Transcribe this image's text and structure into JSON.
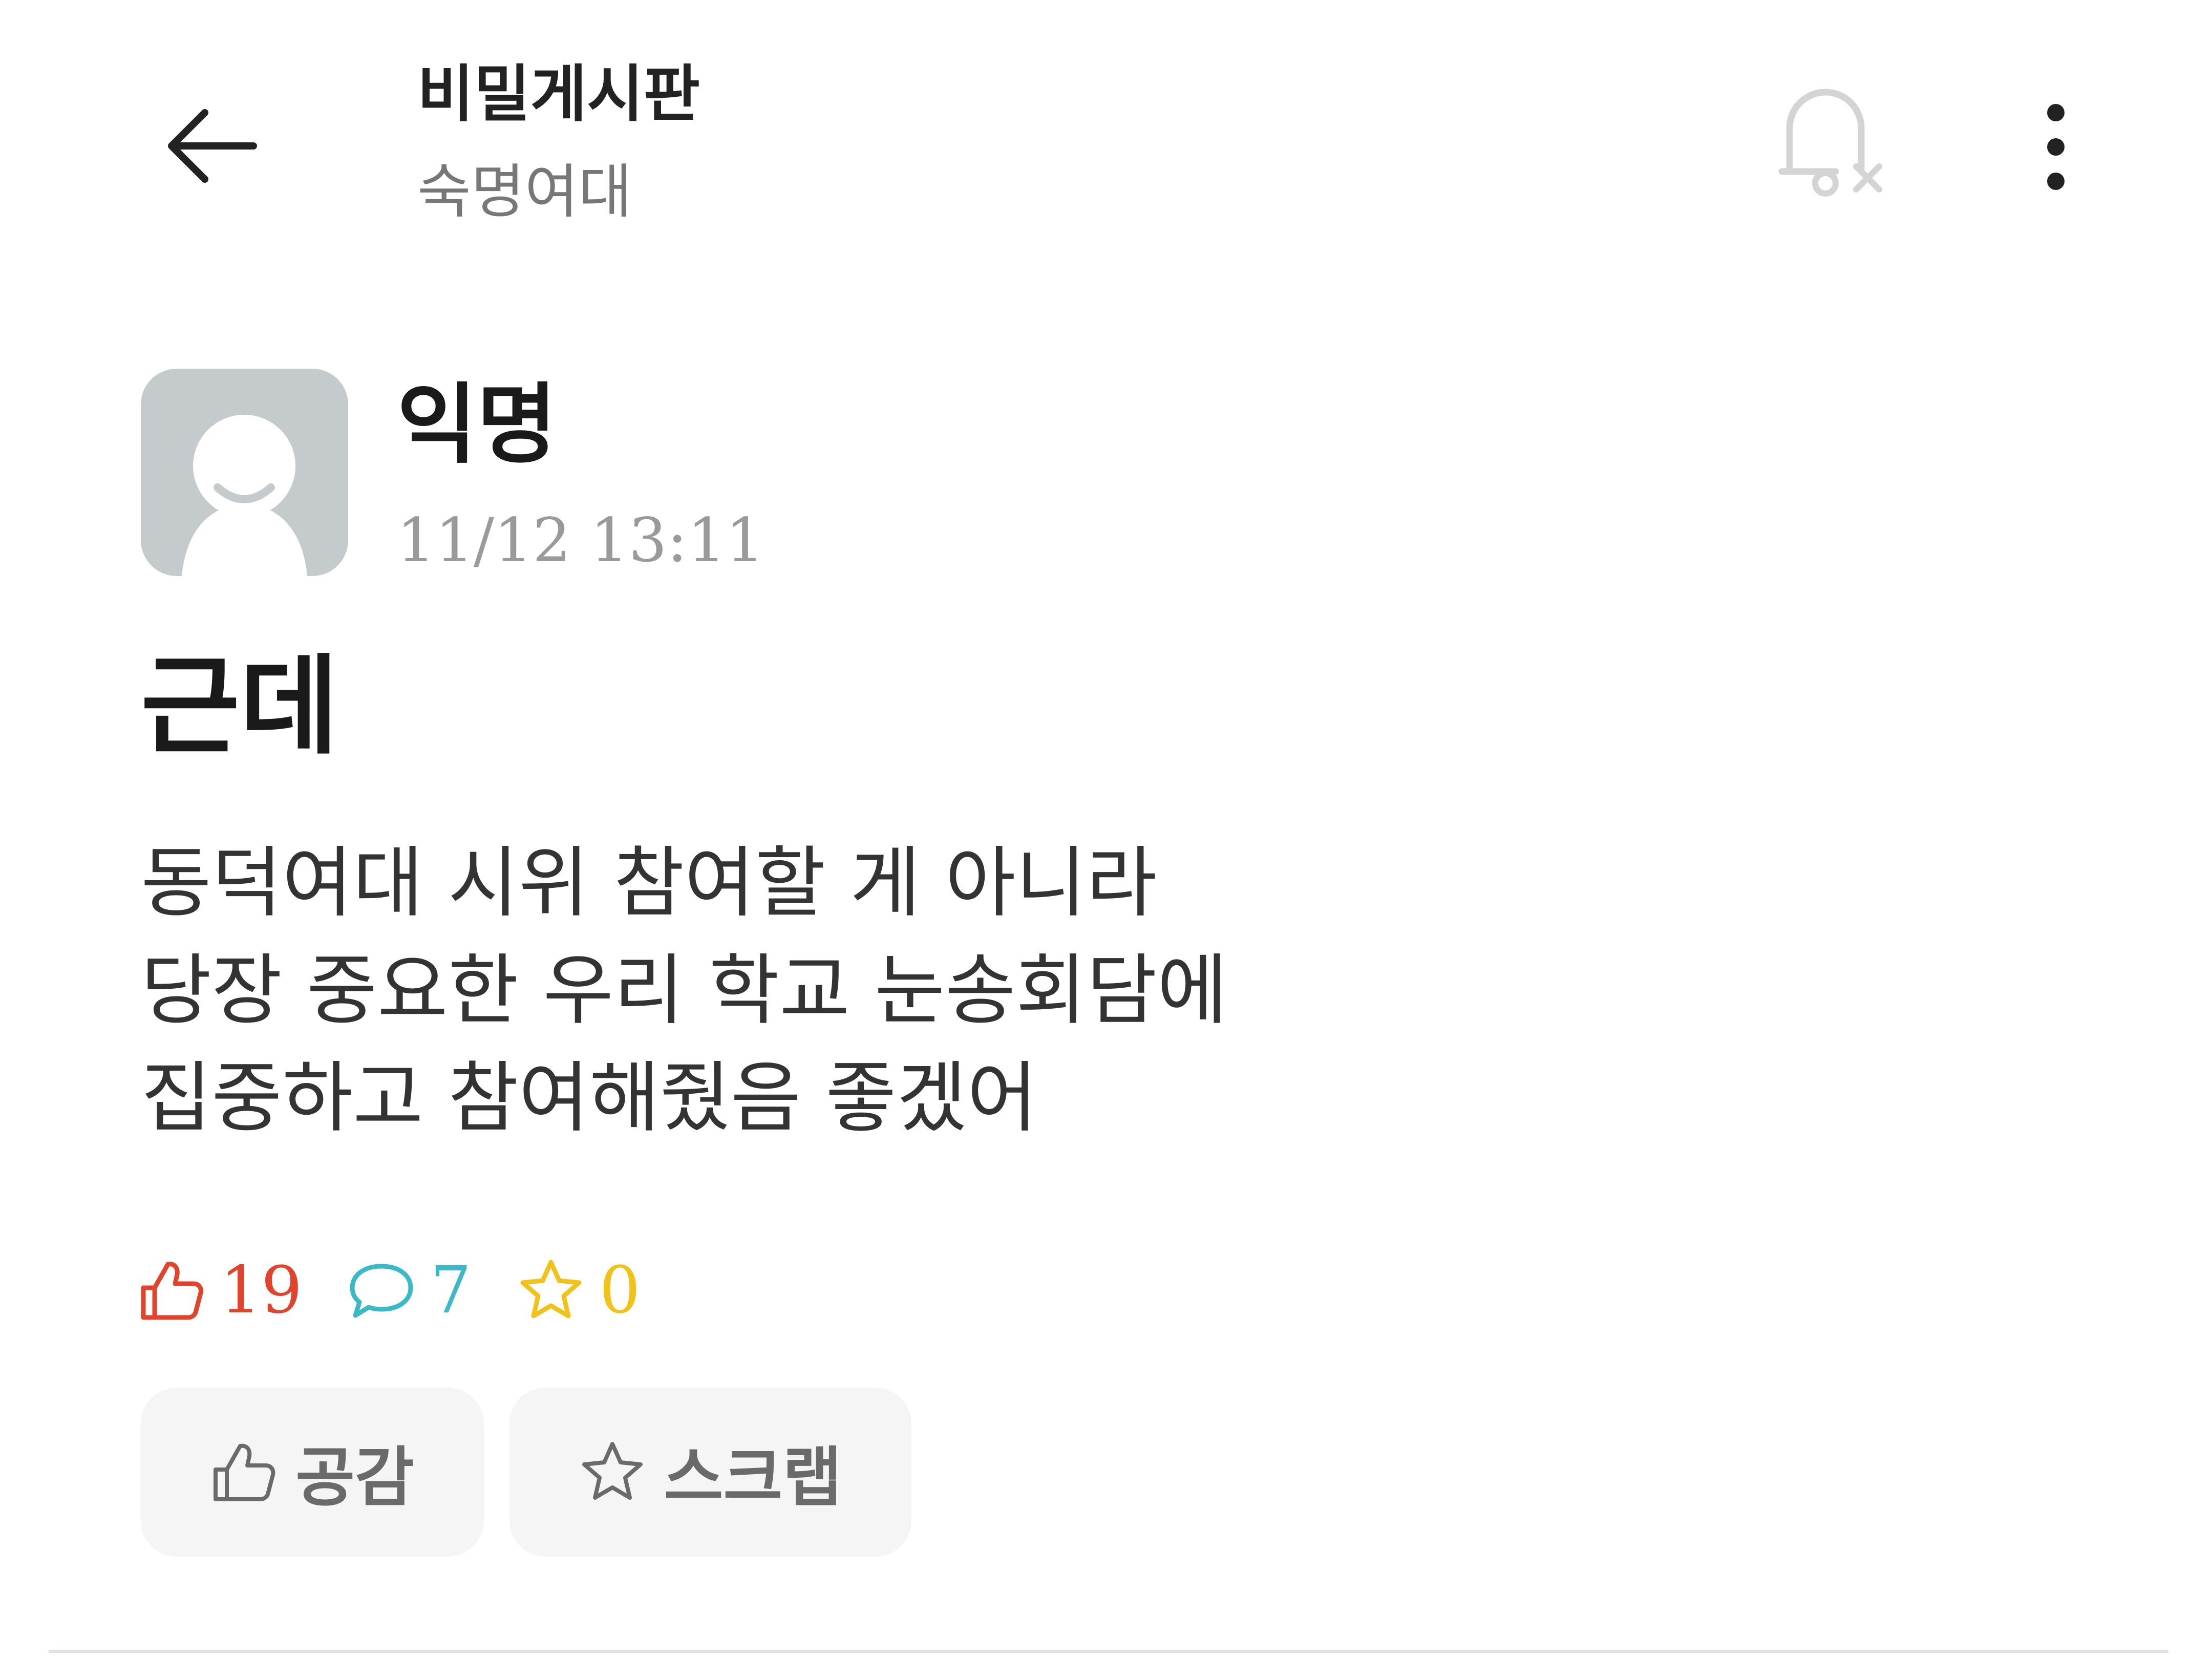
{
  "header": {
    "back_icon": "arrow-left-icon",
    "board_title": "비밀게시판",
    "board_subtitle": "숙명여대",
    "notification_icon": "bell-off-icon",
    "more_icon": "more-vertical-icon"
  },
  "post": {
    "author": "익명",
    "timestamp": "11/12 13:11",
    "title": "근데",
    "body_lines": [
      "동덕여대 시위 참여할 게 아니라",
      "당장 중요한 우리 학교 눈송회담에",
      "집중하고 참여해줬음 좋겠어"
    ]
  },
  "stats": {
    "likes": "19",
    "comments": "7",
    "scraps": "0"
  },
  "actions": {
    "like_label": "공감",
    "scrap_label": "스크랩"
  },
  "colors": {
    "like": "#e0442c",
    "comment": "#3bb9c9",
    "scrap": "#f2c21b",
    "avatar_bg": "#c5cacc",
    "button_bg": "#f5f5f5"
  }
}
